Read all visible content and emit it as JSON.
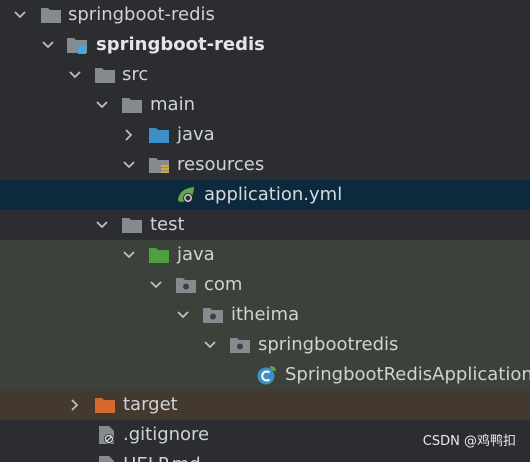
{
  "tree": {
    "items": [
      {
        "label": "springboot-redis"
      },
      {
        "label": "springboot-redis"
      },
      {
        "label": "src"
      },
      {
        "label": "main"
      },
      {
        "label": "java"
      },
      {
        "label": "resources"
      },
      {
        "label": "application.yml"
      },
      {
        "label": "test"
      },
      {
        "label": "java"
      },
      {
        "label": "com"
      },
      {
        "label": "itheima"
      },
      {
        "label": "springbootredis"
      },
      {
        "label": "SpringbootRedisApplication"
      },
      {
        "label": "target"
      },
      {
        "label": ".gitignore"
      },
      {
        "label": "HELP.md"
      }
    ]
  },
  "icons": {
    "folder": "folder-icon",
    "module": "module-folder-icon",
    "source_root": "source-root-folder-icon",
    "resources_root": "resources-root-folder-icon",
    "test_root": "test-source-root-folder-icon",
    "package": "package-icon",
    "spring_config": "spring-config-file-icon",
    "class": "spring-boot-class-icon",
    "excluded": "excluded-folder-icon",
    "gitignore": "gitignore-file-icon",
    "markdown": "markdown-file-icon"
  },
  "colors": {
    "background": "#2b2d30",
    "selected_row": "#0d293e",
    "test_row": "#3c4239",
    "excluded_row": "#43392f",
    "folder": "#878b91",
    "source_root": "#3d8fc6",
    "test_root": "#4f9e3f",
    "excluded": "#d46a2f"
  },
  "watermark": {
    "text": "CSDN @鸡鸭扣"
  }
}
